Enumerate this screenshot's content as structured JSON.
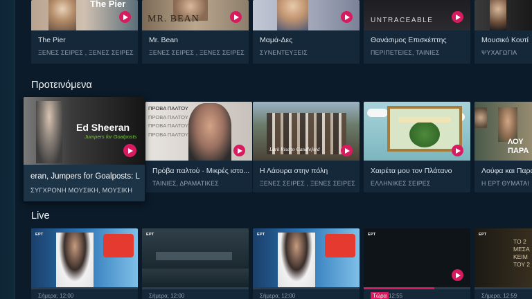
{
  "sections": {
    "recommended_title": "Προτεινόμενα",
    "live_title": "Live"
  },
  "top_row": [
    {
      "title": "The Pier",
      "subtitle": "ΞΕΝΕΣ ΣΕΙΡΕΣ , ΞΕΝΕΣ ΣΕΙΡΕΣ Π...",
      "thumb_text": "The Pier"
    },
    {
      "title": "Mr. Bean",
      "subtitle": "ΞΕΝΕΣ ΣΕΙΡΕΣ , ΞΕΝΕΣ ΣΕΙΡΕΣ Π...",
      "thumb_text": "MR. BEAN"
    },
    {
      "title": "Μαμά-Δες",
      "subtitle": "ΣΥΝΕΝΤΕΥΞΕΙΣ",
      "thumb_text": ""
    },
    {
      "title": "Θανάσιμος Επισκέπτης",
      "subtitle": "ΠΕΡΙΠΕΤΕΙΕΣ, ΤΑΙΝΙΕΣ",
      "thumb_text": "UNTRACEABLE"
    },
    {
      "title": "Μουσικό Κουτί",
      "subtitle": "ΨΥΧΑΓΩΓΙΑ",
      "thumb_text": ""
    }
  ],
  "recommended_row": [
    {
      "title": "eran, Jumpers for Goalposts: L",
      "subtitle": "ΣΥΓΧΡΟΝΗ ΜΟΥΣΙΚΗ, ΜΟΥΣΙΚΗ",
      "thumb_title": "Ed Sheeran",
      "thumb_subtitle": "Jumpers for Goalposts"
    },
    {
      "title": "Πρόβα παλτού · Μικρές ιστο...",
      "subtitle": "ΤΑΙΝΙΕΣ, ΔΡΑΜΑΤΙΚΕΣ",
      "thumb_lines": [
        "ΠΡΟΒΑ ΠΑΛΤΟΥ",
        "ΠΡΟΒΑ ΠΑΛΤΟΥ",
        "ΠΡΟΒΑ ΠΑΛΤΟΥ",
        "ΠΡΟΒΑ ΠΑΛΤΟΥ"
      ]
    },
    {
      "title": "Η Λάουρα στην πόλη",
      "subtitle": "ΞΕΝΕΣ ΣΕΙΡΕΣ , ΞΕΝΕΣ ΣΕΙΡΕΣ Π...",
      "thumb_text": "Lark Rise to Candleford"
    },
    {
      "title": "Χαιρέτα μου τον Πλάτανο",
      "subtitle": "ΕΛΛΗΝΙΚΕΣ ΣΕΙΡΕΣ",
      "thumb_text": ""
    },
    {
      "title": "Λούφα και Παραλλαγή",
      "subtitle": "Η ΕΡΤ ΘΥΜΑΤΑΙ",
      "thumb_text": "ΛΟΥ ΠΑΡΑ"
    }
  ],
  "live_row": [
    {
      "time": "Σήμερα, 12:00",
      "channel": "ΕΡΤ",
      "progress": 0
    },
    {
      "time": "Σήμερα, 12:00",
      "channel": "ΕΡΤ",
      "progress": 0
    },
    {
      "time": "Σήμερα, 12:00",
      "channel": "ΕΡΤ",
      "progress": 0
    },
    {
      "now_label": "Τώρα",
      "time": "12:55",
      "channel": "ΕΡΤ",
      "progress": 0.66
    },
    {
      "time": "Σήμερα, 12:59",
      "channel": "ΕΡΤ",
      "thumb_text": "ΤΟ 2 ΜΕΣΑ ΚΕΙΜ ΤΟΥ 2",
      "progress": 0
    }
  ],
  "colors": {
    "accent": "#d81b5e",
    "background": "#0b1b2a",
    "card": "#14283a"
  }
}
